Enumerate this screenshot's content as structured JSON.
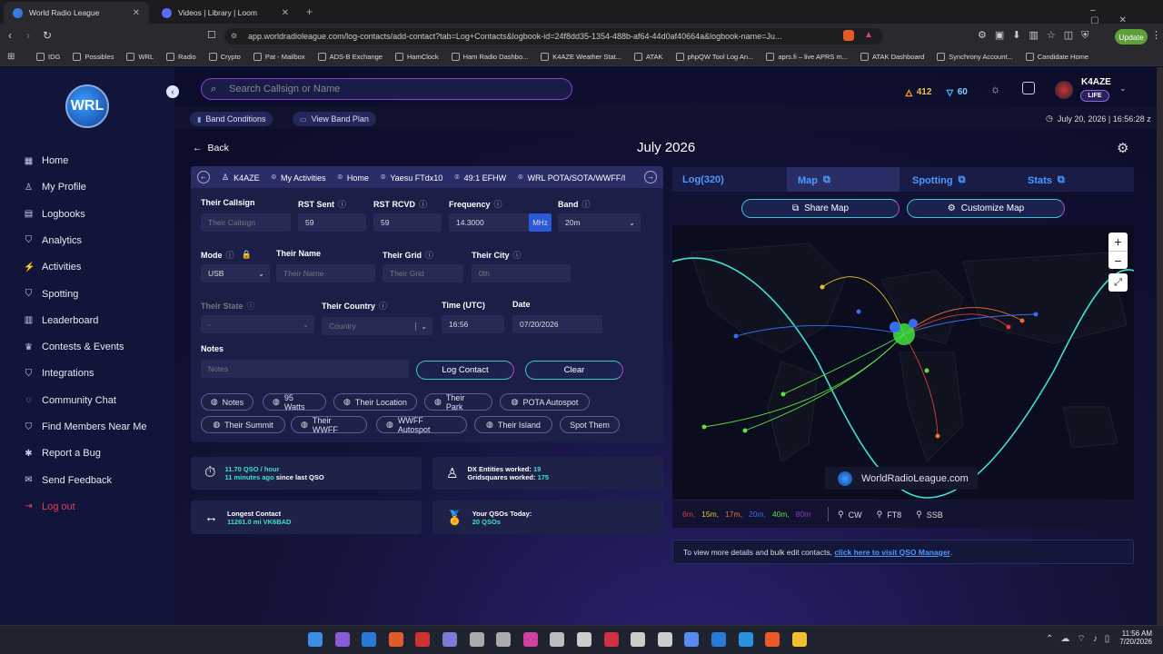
{
  "browser": {
    "tabs": [
      {
        "label": "World Radio League",
        "active": true
      },
      {
        "label": "Videos | Library | Loom",
        "active": false
      }
    ],
    "url": "app.worldradioleague.com/log-contacts/add-contact?tab=Log+Contacts&logbook-id=24f8dd35-1354-488b-af64-44d0af40664a&logbook-name=Ju...",
    "update_label": "Update",
    "bookmarks": [
      "IDG",
      "Possibles",
      "WRL",
      "Radio",
      "Crypto",
      "Pat - Mailbox",
      "ADS-B Exchange",
      "HamClock",
      "Ham Radio Dashbo...",
      "K4AZE Weather Stat...",
      "ATAK",
      "phpQW Tool Log An...",
      "aprs.fi – live APRS m...",
      "ATAK Dashboard",
      "Synchrony Account...",
      "Candidate Home"
    ]
  },
  "header": {
    "search_placeholder": "Search Callsign or Name",
    "flame_count": "412",
    "drop_count": "60",
    "user_callsign": "K4AZE",
    "user_badge": "LIFE",
    "band_conditions": "Band Conditions",
    "band_plan": "View Band Plan",
    "datetime": "July 20, 2026 | 16:56:28 z"
  },
  "sidebar": {
    "logo": "WRL",
    "items": [
      {
        "label": "Home",
        "icon": "grid-icon"
      },
      {
        "label": "My Profile",
        "icon": "user-icon"
      },
      {
        "label": "Logbooks",
        "icon": "book-icon"
      },
      {
        "label": "Analytics",
        "icon": "shield-icon"
      },
      {
        "label": "Activities",
        "icon": "activity-icon"
      },
      {
        "label": "Spotting",
        "icon": "shield-icon"
      },
      {
        "label": "Leaderboard",
        "icon": "leaderboard-icon"
      },
      {
        "label": "Contests & Events",
        "icon": "trophy-icon"
      },
      {
        "label": "Integrations",
        "icon": "shield-icon"
      },
      {
        "label": "Community Chat",
        "icon": "chat-icon"
      },
      {
        "label": "Find Members Near Me",
        "icon": "shield-icon"
      },
      {
        "label": "Report a Bug",
        "icon": "bug-icon"
      },
      {
        "label": "Send Feedback",
        "icon": "feedback-icon"
      },
      {
        "label": "Log out",
        "icon": "logout-icon"
      }
    ]
  },
  "main": {
    "back_label": "Back",
    "page_title": "July 2026",
    "crumbs": [
      "K4AZE",
      "My Activities",
      "Home",
      "Yaesu FTdx10",
      "49:1 EFHW",
      "WRL POTA/SOTA/WWFF/I"
    ],
    "form": {
      "their_callsign": {
        "label": "Their Callsign",
        "placeholder": "Their Callsign"
      },
      "rst_sent": {
        "label": "RST Sent",
        "value": "59"
      },
      "rst_rcvd": {
        "label": "RST RCVD",
        "value": "59"
      },
      "frequency": {
        "label": "Frequency",
        "value": "14.3000",
        "unit": "MHz"
      },
      "band": {
        "label": "Band",
        "value": "20m"
      },
      "mode": {
        "label": "Mode",
        "value": "USB"
      },
      "their_name": {
        "label": "Their Name",
        "placeholder": "Their Name"
      },
      "their_grid": {
        "label": "Their Grid",
        "placeholder": "Their Grid"
      },
      "their_city": {
        "label": "Their City",
        "placeholder": "0th"
      },
      "their_state": {
        "label": "Their State",
        "value": "-"
      },
      "their_country": {
        "label": "Their Country",
        "placeholder": "Country"
      },
      "time": {
        "label": "Time (UTC)",
        "value": "16:56"
      },
      "date": {
        "label": "Date",
        "value": "07/20/2026"
      },
      "notes": {
        "label": "Notes",
        "placeholder": "Notes"
      },
      "log_contact": "Log Contact",
      "clear": "Clear"
    },
    "chips": [
      "Notes",
      "95 Watts",
      "Their Location",
      "Their Park",
      "POTA Autospot",
      "Their Summit",
      "Their WWFF",
      "WWFF Autospot",
      "Their Island",
      "Spot Them"
    ],
    "stats": {
      "rate": "11.70 QSO / hour",
      "last_qso_ago": "11 minutes ago",
      "last_qso_suffix": "since last QSO",
      "dx_label": "DX Entities worked:",
      "dx_value": "19",
      "grid_label": "Gridsquares worked:",
      "grid_value": "175",
      "longest_label": "Longest Contact",
      "longest_value": "11261.0 mi VK6BAD",
      "today_label": "Your QSOs Today:",
      "today_value": "20 QSOs"
    }
  },
  "map_panel": {
    "tabs": [
      "Log(320)",
      "Map",
      "Spotting",
      "Stats"
    ],
    "share": "Share Map",
    "customize": "Customize Map",
    "watermark": "WorldRadioLeague.com",
    "bands": [
      {
        "label": "6m",
        "color": "#e03a3a"
      },
      {
        "label": "15m",
        "color": "#f0c020"
      },
      {
        "label": "17m",
        "color": "#f07030"
      },
      {
        "label": "20m",
        "color": "#3a6cf0"
      },
      {
        "label": "40m",
        "color": "#5ee040"
      },
      {
        "label": "80m",
        "color": "#8a3ad0"
      }
    ],
    "modes": [
      "CW",
      "FT8",
      "SSB"
    ],
    "footer_text": "To view more details and bulk edit contacts, ",
    "footer_link": "click here to visit QSO Manager",
    "zoom_in": "+",
    "zoom_out": "−"
  },
  "taskbar": {
    "time": "11:56 AM",
    "date": "7/20/2026"
  }
}
